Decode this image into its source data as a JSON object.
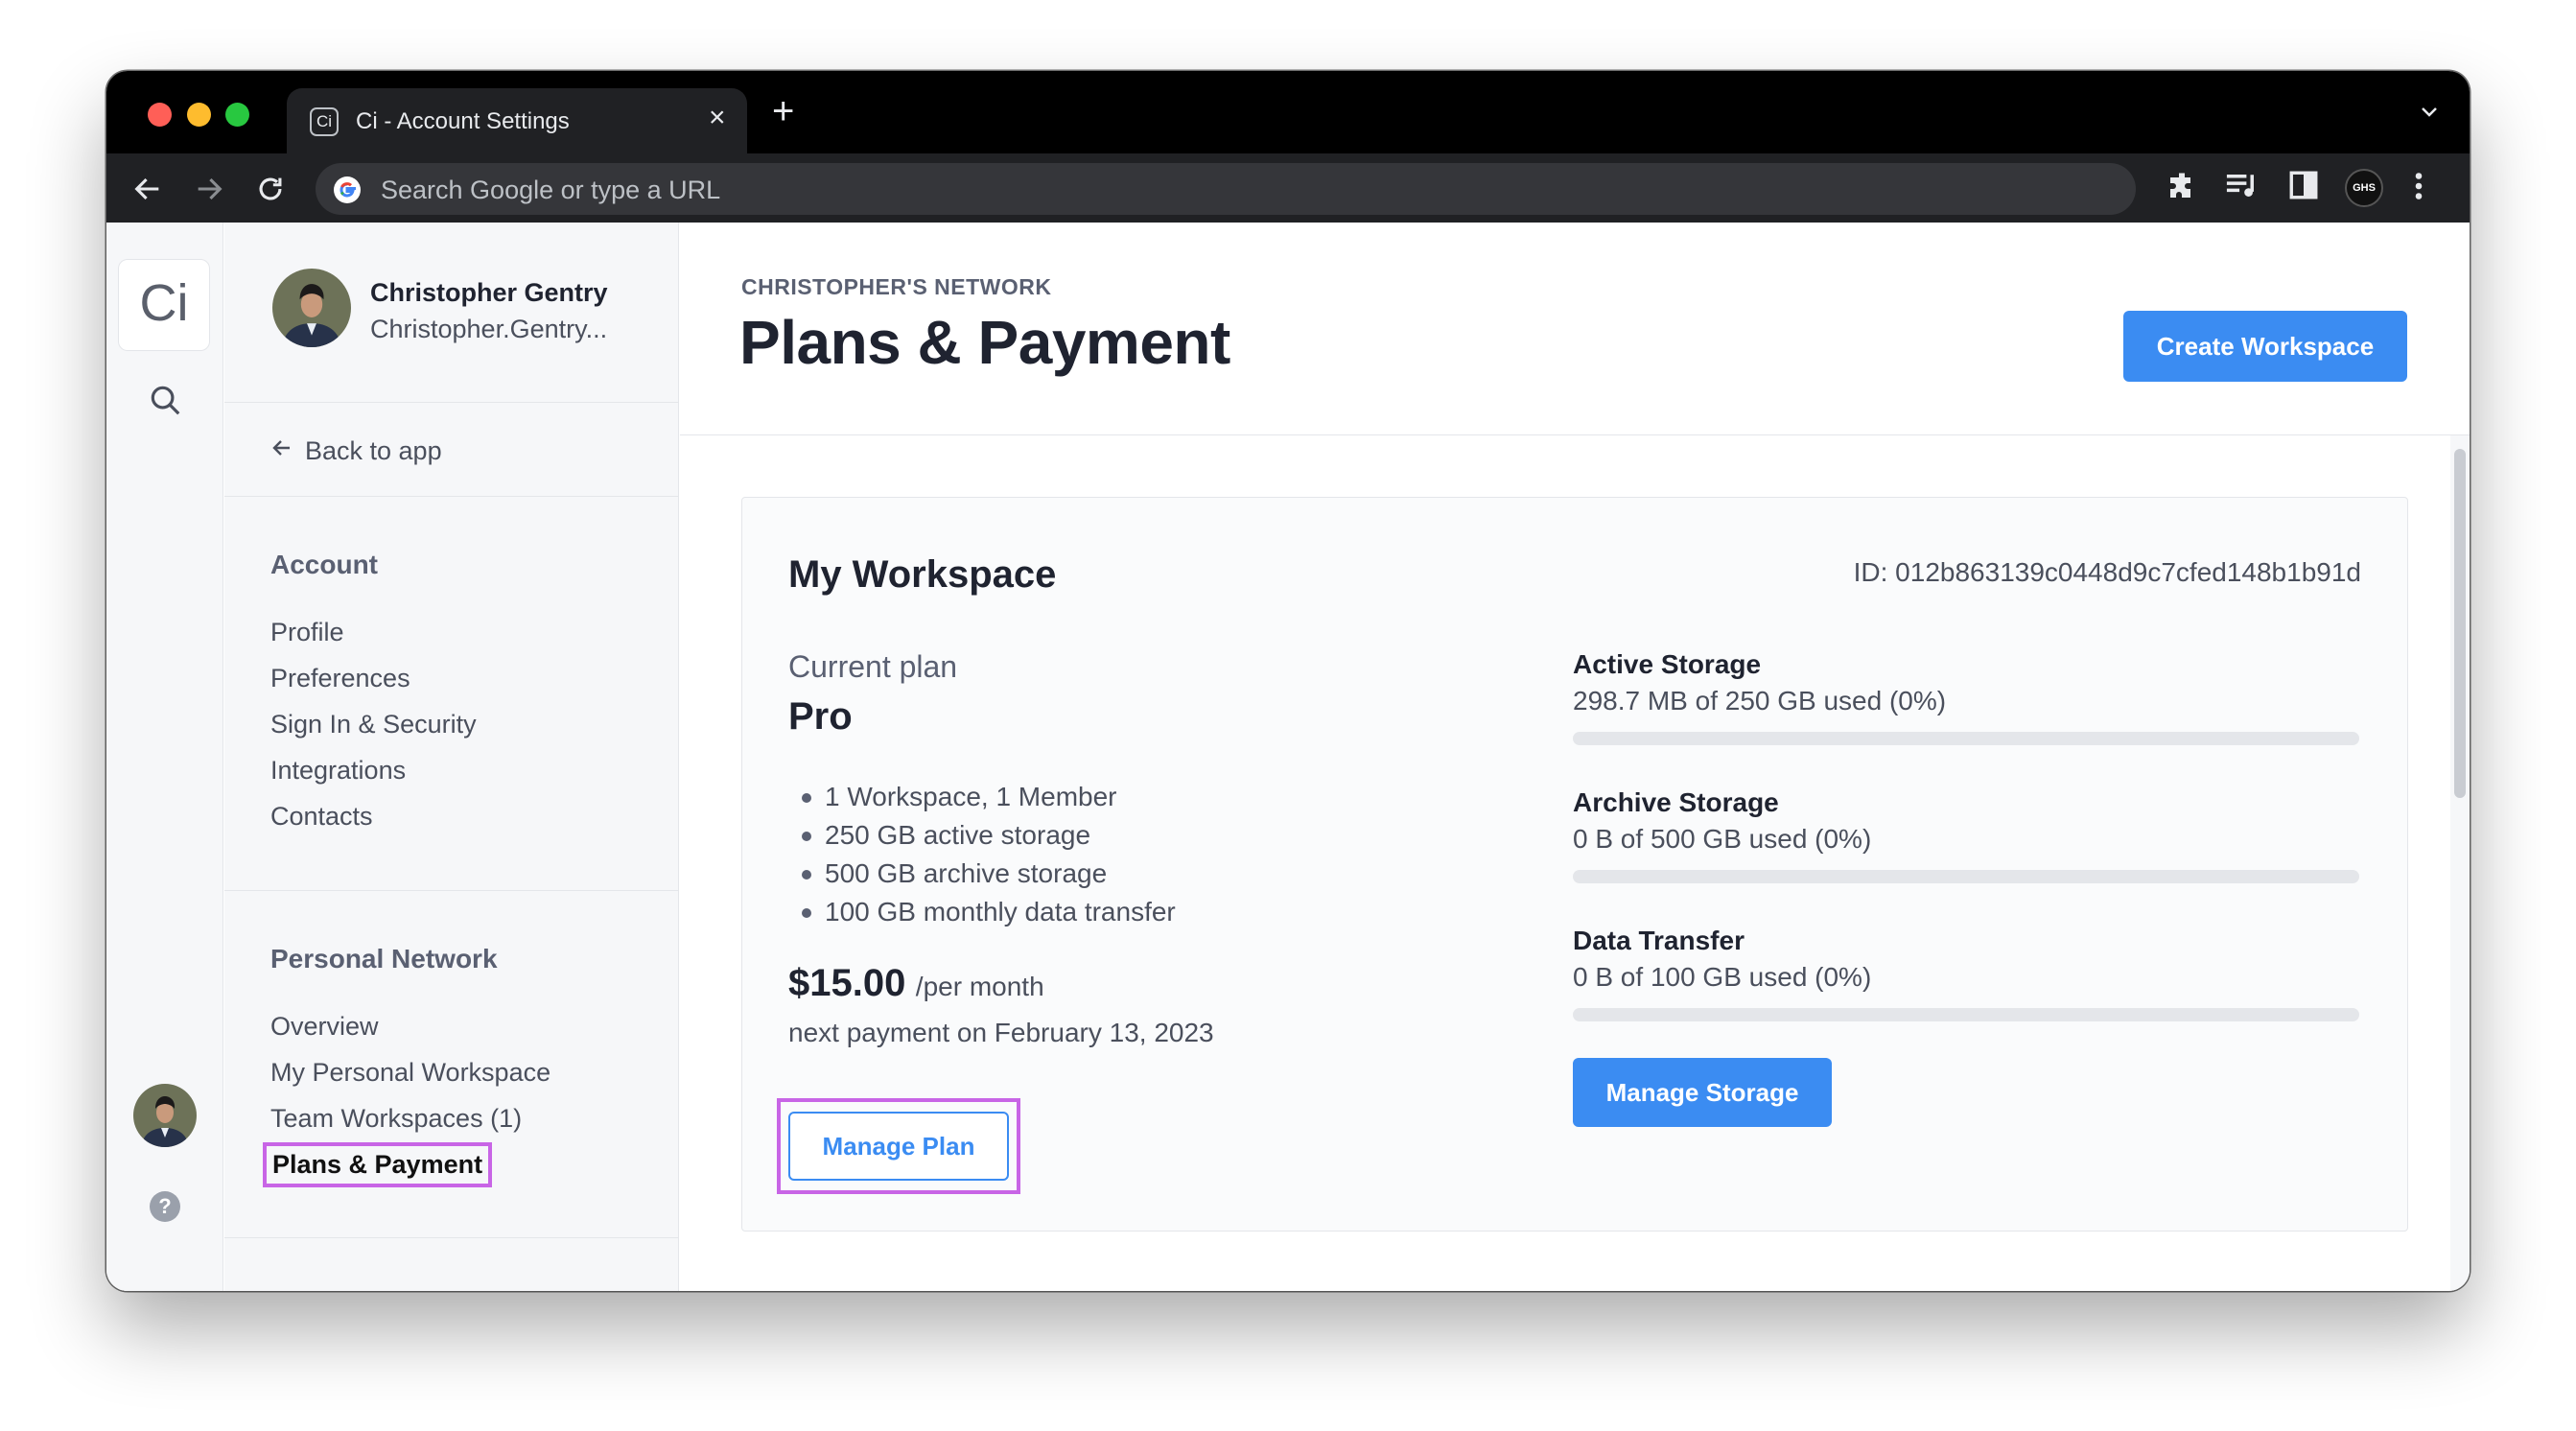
{
  "browser": {
    "tab_title": "Ci - Account Settings",
    "tab_favicon": "Ci",
    "omnibox_placeholder": "Search Google or type a URL",
    "profile_badge": "GHS"
  },
  "rail": {
    "logo_text": "Ci",
    "icons": [
      "search-icon",
      "avatar",
      "help-icon"
    ]
  },
  "sidebar": {
    "user": {
      "name": "Christopher Gentry",
      "email": "Christopher.Gentry..."
    },
    "back_label": "Back to app",
    "account": {
      "title": "Account",
      "items": [
        "Profile",
        "Preferences",
        "Sign In & Security",
        "Integrations",
        "Contacts"
      ]
    },
    "network": {
      "title": "Personal Network",
      "items": [
        "Overview",
        "My Personal Workspace",
        "Team Workspaces (1)",
        "Plans & Payment"
      ],
      "active": "Plans & Payment"
    }
  },
  "main": {
    "network_label": "CHRISTOPHER'S NETWORK",
    "title": "Plans & Payment",
    "create_button": "Create Workspace",
    "workspace": {
      "name": "My Workspace",
      "id_text": "ID: 012b863139c0448d9c7cfed148b1b91d",
      "current_plan_label": "Current plan",
      "plan_name": "Pro",
      "features": [
        "1 Workspace, 1 Member",
        "250 GB active storage",
        "500 GB archive storage",
        "100 GB monthly data transfer"
      ],
      "price": "$15.00",
      "price_period": "/per month",
      "next_payment": "next payment on February 13, 2023",
      "manage_plan_button": "Manage Plan",
      "storage": [
        {
          "name": "Active Storage",
          "used": "298.7 MB of 250 GB used (0%)",
          "percent": 0
        },
        {
          "name": "Archive Storage",
          "used": "0 B of 500 GB used (0%)",
          "percent": 0
        },
        {
          "name": "Data Transfer",
          "used": "0 B of 100 GB used (0%)",
          "percent": 0
        }
      ],
      "manage_storage_button": "Manage Storage"
    }
  },
  "colors": {
    "accent": "#3b8cf2",
    "highlight": "#c865e6"
  }
}
